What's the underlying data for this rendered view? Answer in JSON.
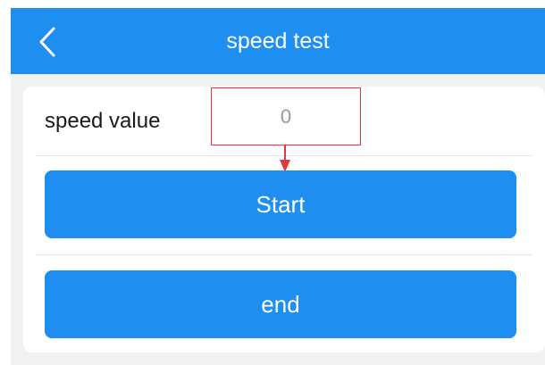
{
  "header": {
    "title": "speed test",
    "back_icon": "chevron-left-icon",
    "background_color": "#1E8FF0"
  },
  "speed": {
    "label": "speed value",
    "value": "0",
    "highlight_color": "#E0393E"
  },
  "buttons": {
    "start_label": "Start",
    "end_label": "end",
    "color": "#1E8FF0"
  },
  "annotation": {
    "arrow_icon": "red-arrow-down-icon"
  }
}
